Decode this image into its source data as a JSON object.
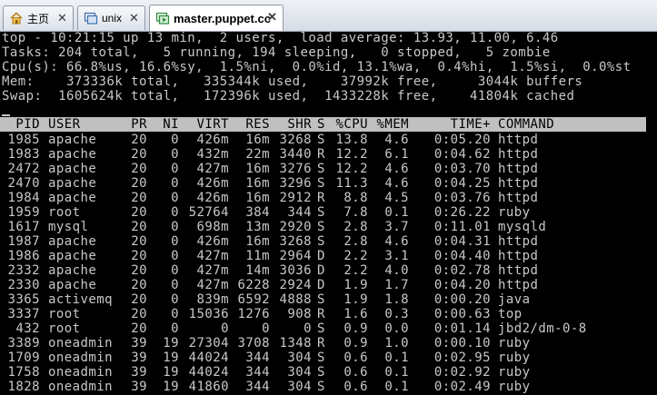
{
  "tabs": [
    {
      "label": "主页",
      "icon": "home-icon",
      "active": false
    },
    {
      "label": "unix",
      "icon": "vm-icon",
      "active": false
    },
    {
      "label": "master.puppet.cc",
      "icon": "vm-icon",
      "active": true
    }
  ],
  "summary": {
    "line1": "top - 10:21:15 up 13 min,  2 users,  load average: 13.93, 11.00, 6.46",
    "line2": "Tasks: 204 total,   5 running, 194 sleeping,   0 stopped,   5 zombie",
    "line3": "Cpu(s): 66.8%us, 16.6%sy,  1.5%ni,  0.0%id, 13.1%wa,  0.4%hi,  1.5%si,  0.0%st",
    "line4": "Mem:    373336k total,   335344k used,    37992k free,     3044k buffers",
    "line5": "Swap:  1605624k total,   172396k used,  1433228k free,    41804k cached"
  },
  "columns": [
    "PID",
    "USER",
    "PR",
    "NI",
    "VIRT",
    "RES",
    "SHR",
    "S",
    "%CPU",
    "%MEM",
    "TIME+",
    "COMMAND"
  ],
  "processes": [
    [
      "1985",
      "apache",
      "20",
      "0",
      "426m",
      "16m",
      "3268",
      "S",
      "13.8",
      "4.6",
      "0:05.20",
      "httpd"
    ],
    [
      "1983",
      "apache",
      "20",
      "0",
      "432m",
      "22m",
      "3440",
      "R",
      "12.2",
      "6.1",
      "0:04.62",
      "httpd"
    ],
    [
      "2472",
      "apache",
      "20",
      "0",
      "427m",
      "16m",
      "3276",
      "S",
      "12.2",
      "4.6",
      "0:03.70",
      "httpd"
    ],
    [
      "2470",
      "apache",
      "20",
      "0",
      "426m",
      "16m",
      "3296",
      "S",
      "11.3",
      "4.6",
      "0:04.25",
      "httpd"
    ],
    [
      "1984",
      "apache",
      "20",
      "0",
      "426m",
      "16m",
      "2912",
      "R",
      "8.8",
      "4.5",
      "0:03.76",
      "httpd"
    ],
    [
      "1959",
      "root",
      "20",
      "0",
      "52764",
      "384",
      "344",
      "S",
      "7.8",
      "0.1",
      "0:26.22",
      "ruby"
    ],
    [
      "1617",
      "mysql",
      "20",
      "0",
      "698m",
      "13m",
      "2920",
      "S",
      "2.8",
      "3.7",
      "0:11.01",
      "mysqld"
    ],
    [
      "1987",
      "apache",
      "20",
      "0",
      "426m",
      "16m",
      "3268",
      "S",
      "2.8",
      "4.6",
      "0:04.31",
      "httpd"
    ],
    [
      "1986",
      "apache",
      "20",
      "0",
      "427m",
      "11m",
      "2964",
      "D",
      "2.2",
      "3.1",
      "0:04.40",
      "httpd"
    ],
    [
      "2332",
      "apache",
      "20",
      "0",
      "427m",
      "14m",
      "3036",
      "D",
      "2.2",
      "4.0",
      "0:02.78",
      "httpd"
    ],
    [
      "2330",
      "apache",
      "20",
      "0",
      "427m",
      "6228",
      "2924",
      "D",
      "1.9",
      "1.7",
      "0:04.20",
      "httpd"
    ],
    [
      "3365",
      "activemq",
      "20",
      "0",
      "839m",
      "6592",
      "4888",
      "S",
      "1.9",
      "1.8",
      "0:00.20",
      "java"
    ],
    [
      "3337",
      "root",
      "20",
      "0",
      "15036",
      "1276",
      "908",
      "R",
      "1.6",
      "0.3",
      "0:00.63",
      "top"
    ],
    [
      "432",
      "root",
      "20",
      "0",
      "0",
      "0",
      "0",
      "S",
      "0.9",
      "0.0",
      "0:01.14",
      "jbd2/dm-0-8"
    ],
    [
      "3389",
      "oneadmin",
      "39",
      "19",
      "27304",
      "3708",
      "1348",
      "R",
      "0.9",
      "1.0",
      "0:00.10",
      "ruby"
    ],
    [
      "1709",
      "oneadmin",
      "39",
      "19",
      "44024",
      "344",
      "304",
      "S",
      "0.6",
      "0.1",
      "0:02.95",
      "ruby"
    ],
    [
      "1758",
      "oneadmin",
      "39",
      "19",
      "44024",
      "344",
      "304",
      "S",
      "0.6",
      "0.1",
      "0:02.92",
      "ruby"
    ],
    [
      "1828",
      "oneadmin",
      "39",
      "19",
      "41860",
      "344",
      "304",
      "S",
      "0.6",
      "0.1",
      "0:02.49",
      "ruby"
    ]
  ],
  "colors": {
    "terminal_bg": "#000000",
    "terminal_fg": "#c8c8c8",
    "header_bar": "#c0c0c0"
  }
}
